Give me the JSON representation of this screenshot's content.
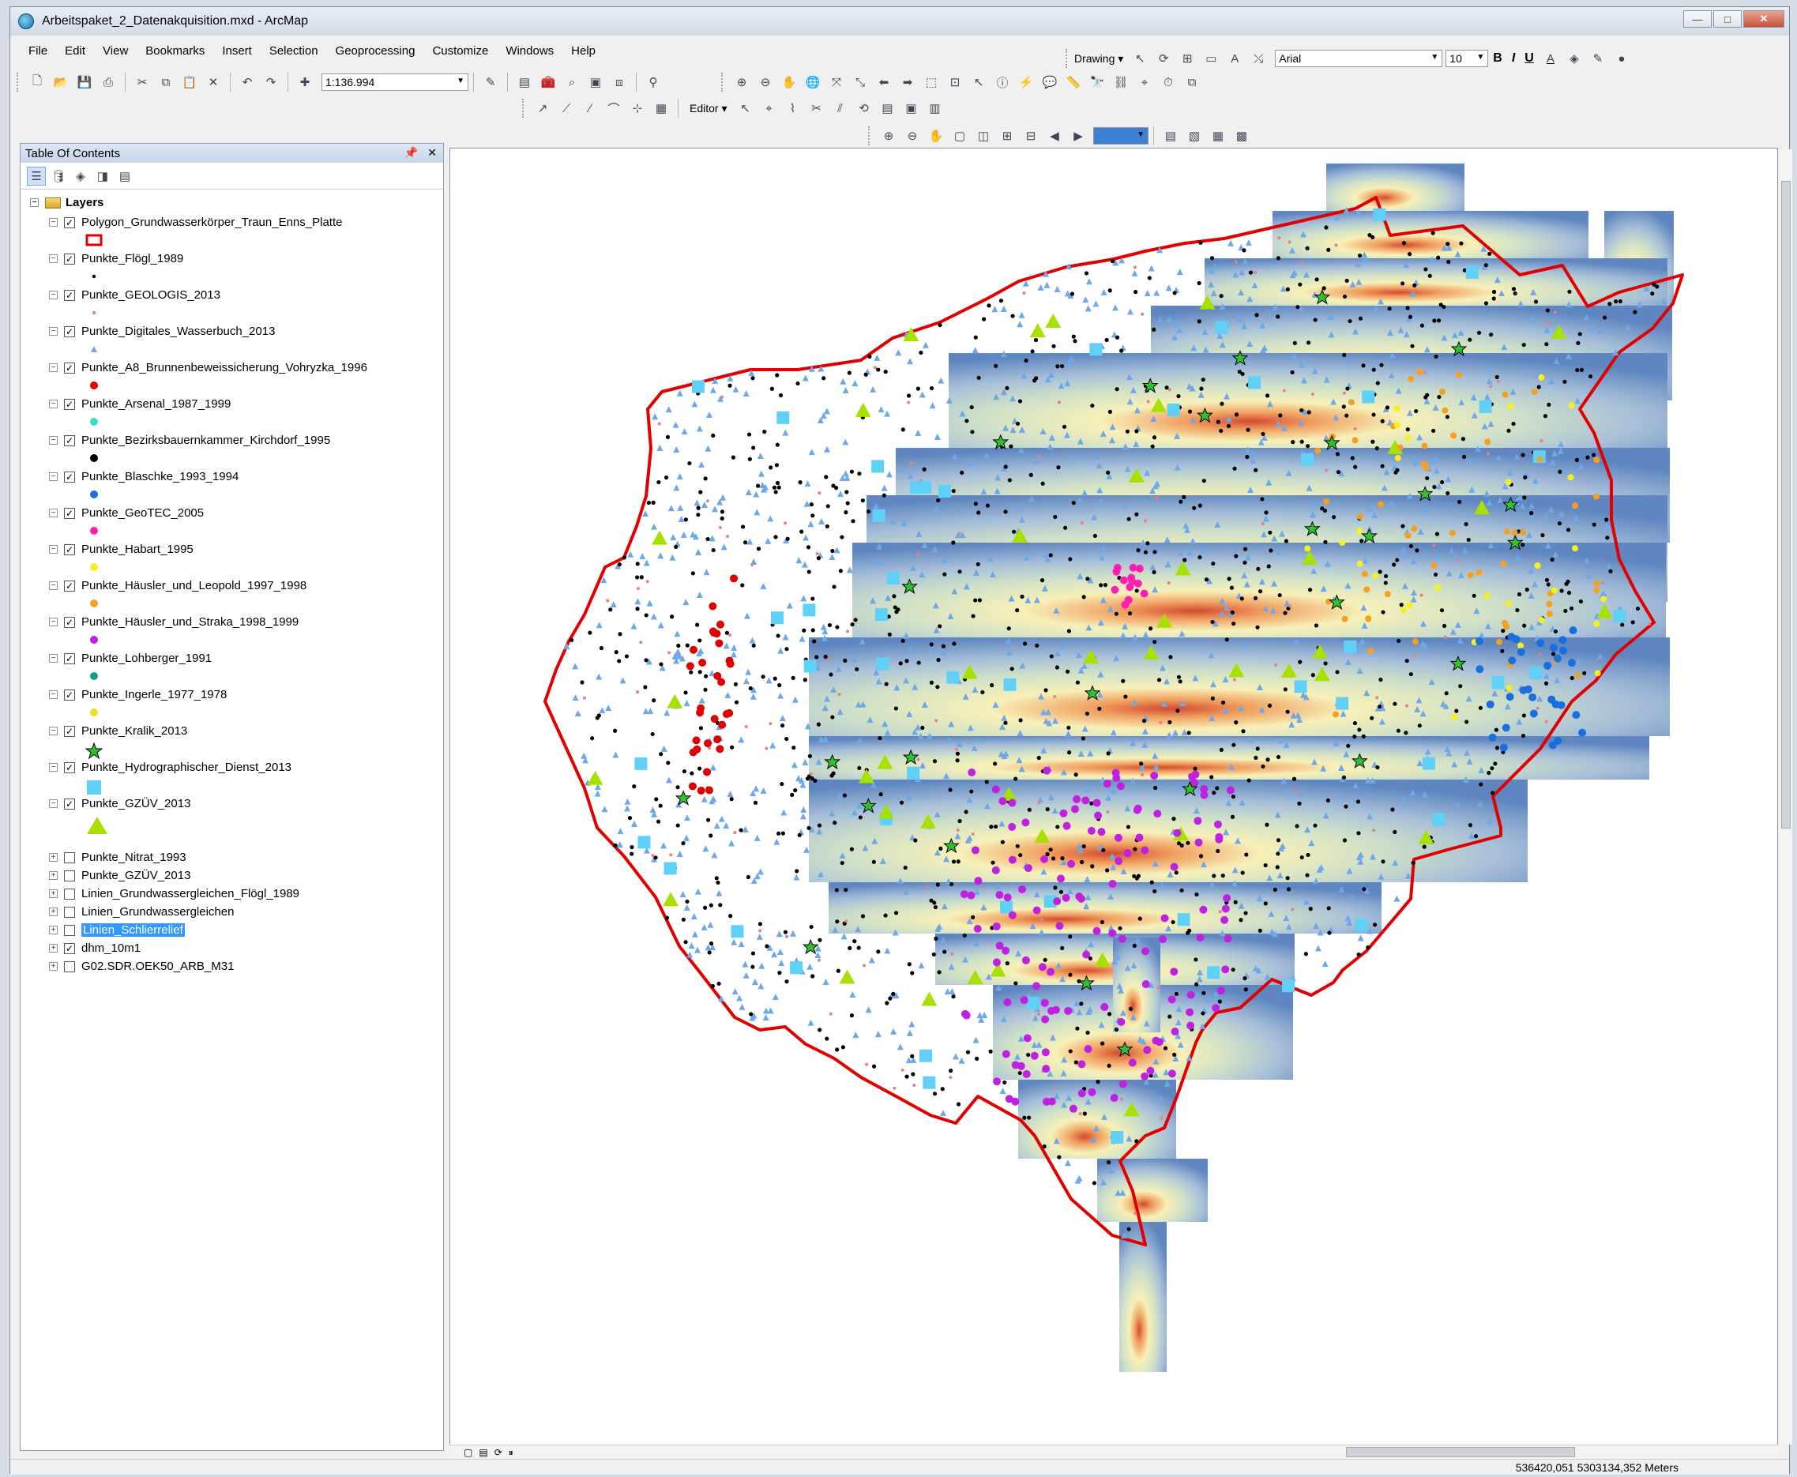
{
  "window": {
    "title": "Arbeitspaket_2_Datenakquisition.mxd - ArcMap"
  },
  "menu": [
    "File",
    "Edit",
    "View",
    "Bookmarks",
    "Insert",
    "Selection",
    "Geoprocessing",
    "Customize",
    "Windows",
    "Help"
  ],
  "toolbar": {
    "scale": "1:136.994",
    "drawing_label": "Drawing ▾",
    "font_name": "Arial",
    "font_size": "10",
    "editor_label": "Editor ▾",
    "bold": "B",
    "italic": "I",
    "underline": "U"
  },
  "toc": {
    "title": "Table Of Contents",
    "root": "Layers",
    "layers": [
      {
        "name": "Polygon_Grundwasserkörper_Traun_Enns_Platte",
        "checked": true,
        "expanded": true,
        "symbol": "rect-red",
        "color": "#e00000"
      },
      {
        "name": "Punkte_Flögl_1989",
        "checked": true,
        "expanded": true,
        "symbol": "dot",
        "color": "#000000"
      },
      {
        "name": "Punkte_GEOLOGIS_2013",
        "checked": true,
        "expanded": true,
        "symbol": "dot",
        "color": "#e88080"
      },
      {
        "name": "Punkte_Digitales_Wasserbuch_2013",
        "checked": true,
        "expanded": true,
        "symbol": "triangle",
        "color": "#6fa8e8"
      },
      {
        "name": "Punkte_A8_Brunnenbeweissicherung_Vohryzka_1996",
        "checked": true,
        "expanded": true,
        "symbol": "circle",
        "color": "#e00000"
      },
      {
        "name": "Punkte_Arsenal_1987_1999",
        "checked": true,
        "expanded": true,
        "symbol": "circle",
        "color": "#34e0c0"
      },
      {
        "name": "Punkte_Bezirksbauernkammer_Kirchdorf_1995",
        "checked": true,
        "expanded": true,
        "symbol": "circle",
        "color": "#000000"
      },
      {
        "name": "Punkte_Blaschke_1993_1994",
        "checked": true,
        "expanded": true,
        "symbol": "circle",
        "color": "#1a6fe0"
      },
      {
        "name": "Punkte_GeoTEC_2005",
        "checked": true,
        "expanded": true,
        "symbol": "circle",
        "color": "#ff20b0"
      },
      {
        "name": "Punkte_Habart_1995",
        "checked": true,
        "expanded": true,
        "symbol": "circle",
        "color": "#f5f020"
      },
      {
        "name": "Punkte_Häusler_und_Leopold_1997_1998",
        "checked": true,
        "expanded": true,
        "symbol": "circle",
        "color": "#f5a020"
      },
      {
        "name": "Punkte_Häusler_und_Straka_1998_1999",
        "checked": true,
        "expanded": true,
        "symbol": "circle",
        "color": "#c020e0"
      },
      {
        "name": "Punkte_Lohberger_1991",
        "checked": true,
        "expanded": true,
        "symbol": "circle",
        "color": "#1a9a80"
      },
      {
        "name": "Punkte_Ingerle_1977_1978",
        "checked": true,
        "expanded": true,
        "symbol": "circle",
        "color": "#f0e020"
      },
      {
        "name": "Punkte_Kralik_2013",
        "checked": true,
        "expanded": true,
        "symbol": "star",
        "color": "#30c030"
      },
      {
        "name": "Punkte_Hydrographischer_Dienst_2013",
        "checked": true,
        "expanded": true,
        "symbol": "square",
        "color": "#5fd0f8"
      },
      {
        "name": "Punkte_GZÜV_2013",
        "checked": true,
        "expanded": true,
        "symbol": "triangle-big",
        "color": "#a8e000"
      },
      {
        "name": "Punkte_Nitrat_1993",
        "checked": false,
        "expanded": false
      },
      {
        "name": "Punkte_GZÜV_2013",
        "checked": false,
        "expanded": false
      },
      {
        "name": "Linien_Grundwassergleichen_Flögl_1989",
        "checked": false,
        "expanded": false
      },
      {
        "name": "Linien_Grundwassergleichen",
        "checked": false,
        "expanded": false
      },
      {
        "name": "Linien_Schlierrelief",
        "checked": false,
        "expanded": false,
        "selected": true
      },
      {
        "name": "dhm_10m1",
        "checked": true,
        "expanded": false
      },
      {
        "name": "G02.SDR.OEK50_ARB_M31",
        "checked": false,
        "expanded": false
      }
    ]
  },
  "status": {
    "coordinates": "536420,051  5303134,352 Meters"
  },
  "colors": {
    "outline": "#e00000",
    "dem_low": "#6a8fc2",
    "dem_mid": "#f4f4c8",
    "dem_high": "#d83a2a"
  }
}
